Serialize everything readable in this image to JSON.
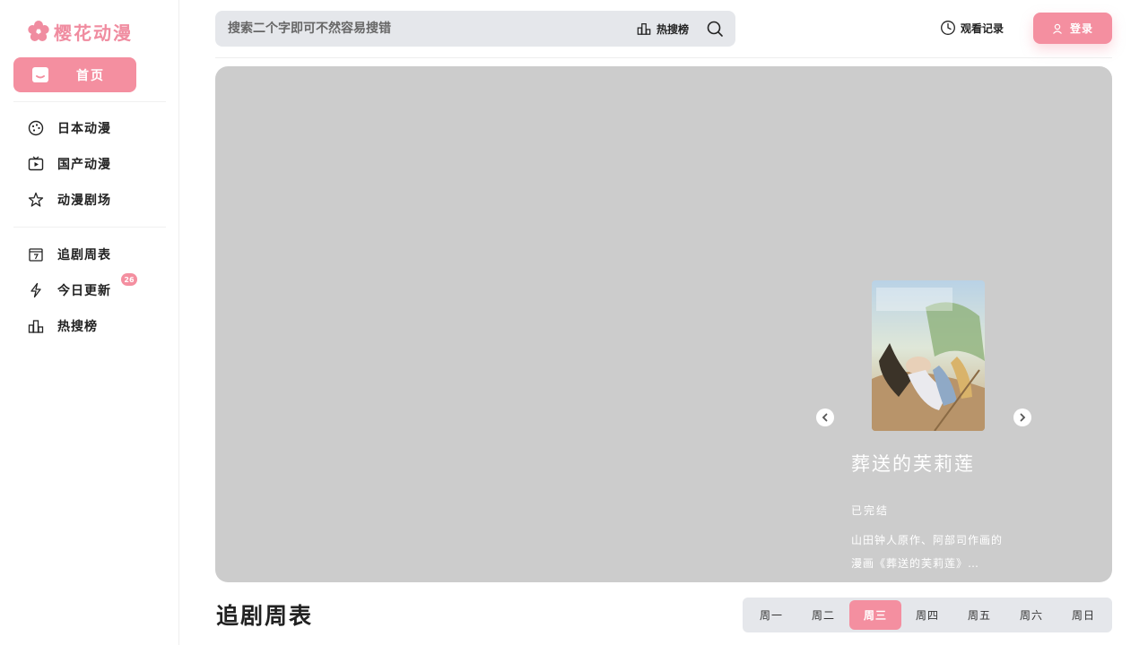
{
  "sidebar": {
    "logo_text": "樱花动漫",
    "home_label": "首页",
    "items": [
      {
        "label": "日本动漫",
        "icon": "palette-icon"
      },
      {
        "label": "国产动漫",
        "icon": "tv-play-icon"
      },
      {
        "label": "动漫剧场",
        "icon": "star-icon"
      },
      {
        "label": "追剧周表",
        "icon": "calendar-icon"
      },
      {
        "label": "今日更新",
        "icon": "lightning-icon"
      },
      {
        "label": "热搜榜",
        "icon": "ranking-icon"
      }
    ],
    "update_badge": "26"
  },
  "header": {
    "search_placeholder": "搜索二个字即可不然容易搜错",
    "hot_label": "热搜榜",
    "history_label": "观看记录",
    "login_label": "登录"
  },
  "banner": {
    "title": "葬送的芙莉莲",
    "status": "已完结",
    "description": "山田钟人原作、阿部司作画的漫画《葬送的芙莉莲》…"
  },
  "schedule": {
    "title": "追剧周表",
    "days": [
      "周一",
      "周二",
      "周三",
      "周四",
      "周五",
      "周六",
      "周日"
    ],
    "active_day": "周三"
  },
  "colors": {
    "accent": "#f48fa0",
    "banner_bg": "#cccccc",
    "search_bg": "#e5e7eb"
  }
}
